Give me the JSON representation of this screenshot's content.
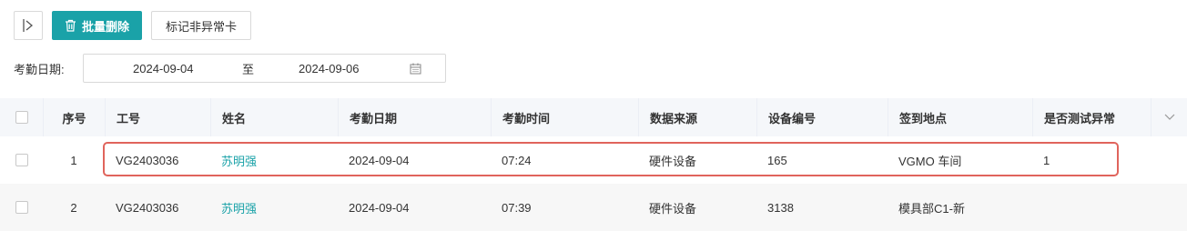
{
  "toolbar": {
    "batch_delete_label": "批量删除",
    "mark_normal_label": "标记非异常卡"
  },
  "filter": {
    "label": "考勤日期:",
    "start_date": "2024-09-04",
    "separator": "至",
    "end_date": "2024-09-06"
  },
  "table": {
    "headers": {
      "seq": "序号",
      "emp_no": "工号",
      "name": "姓名",
      "date": "考勤日期",
      "time": "考勤时间",
      "source": "数据来源",
      "device": "设备编号",
      "location": "签到地点",
      "test": "是否测试异常"
    },
    "rows": [
      {
        "seq": "1",
        "emp_no": "VG2403036",
        "name": "苏明强",
        "date": "2024-09-04",
        "time": "07:24",
        "source": "硬件设备",
        "device": "165",
        "location": "VGMO 车间",
        "test": "1"
      },
      {
        "seq": "2",
        "emp_no": "VG2403036",
        "name": "苏明强",
        "date": "2024-09-04",
        "time": "07:39",
        "source": "硬件设备",
        "device": "3138",
        "location": "模具部C1-新",
        "test": ""
      }
    ]
  },
  "colors": {
    "accent": "#1aa2a8",
    "highlight": "#e0645c"
  }
}
